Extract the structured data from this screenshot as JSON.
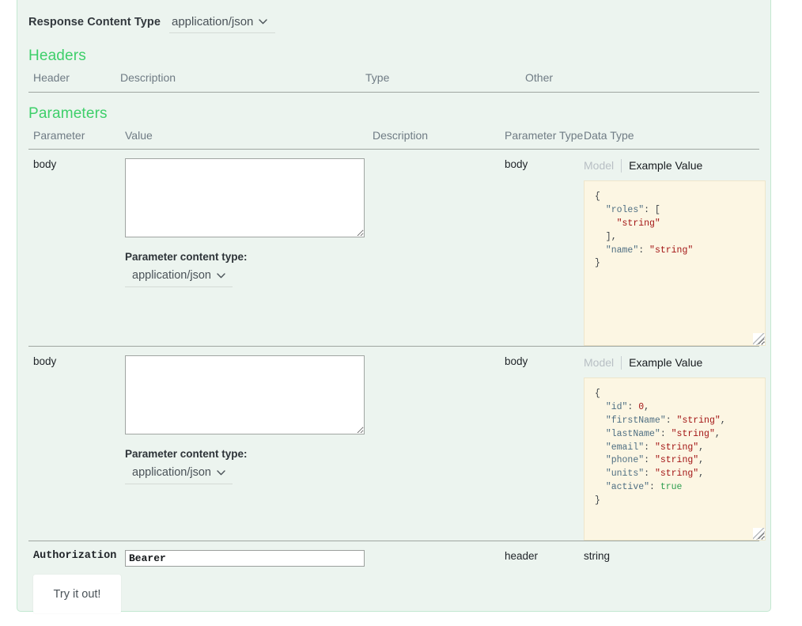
{
  "response_content_type": {
    "label": "Response Content Type",
    "value": "application/json",
    "chevron_icon": "chevron-down-icon"
  },
  "headers_section": {
    "title": "Headers",
    "columns": [
      "Header",
      "Description",
      "Type",
      "Other"
    ],
    "rows": []
  },
  "parameters_section": {
    "title": "Parameters",
    "columns": {
      "parameter": "Parameter",
      "value": "Value",
      "description": "Description",
      "parameter_type": "Parameter Type",
      "data_type": "Data Type"
    },
    "rows": [
      {
        "parameter": "body",
        "value": "",
        "value_placeholder": "",
        "description": "",
        "parameter_type": "body",
        "content_type_label": "Parameter content type:",
        "content_type_value": "application/json",
        "signature_tabs": {
          "model": "Model",
          "example": "Example Value",
          "active": "Example Value"
        },
        "example_lines": [
          [
            {
              "t": "{",
              "c": "punc"
            }
          ],
          [
            {
              "t": "  ",
              "c": "punc"
            },
            {
              "t": "\"roles\"",
              "c": "key"
            },
            {
              "t": ": [",
              "c": "punc"
            }
          ],
          [
            {
              "t": "    ",
              "c": "punc"
            },
            {
              "t": "\"string\"",
              "c": "str"
            }
          ],
          [
            {
              "t": "  ],",
              "c": "punc"
            }
          ],
          [
            {
              "t": "  ",
              "c": "punc"
            },
            {
              "t": "\"name\"",
              "c": "key"
            },
            {
              "t": ": ",
              "c": "punc"
            },
            {
              "t": "\"string\"",
              "c": "str"
            }
          ],
          [
            {
              "t": "}",
              "c": "punc"
            }
          ]
        ]
      },
      {
        "parameter": "body",
        "value": "",
        "value_placeholder": "",
        "description": "",
        "parameter_type": "body",
        "content_type_label": "Parameter content type:",
        "content_type_value": "application/json",
        "signature_tabs": {
          "model": "Model",
          "example": "Example Value",
          "active": "Example Value"
        },
        "example_lines": [
          [
            {
              "t": "{",
              "c": "punc"
            }
          ],
          [
            {
              "t": "  ",
              "c": "punc"
            },
            {
              "t": "\"id\"",
              "c": "key"
            },
            {
              "t": ": ",
              "c": "punc"
            },
            {
              "t": "0",
              "c": "num"
            },
            {
              "t": ",",
              "c": "punc"
            }
          ],
          [
            {
              "t": "  ",
              "c": "punc"
            },
            {
              "t": "\"firstName\"",
              "c": "key"
            },
            {
              "t": ": ",
              "c": "punc"
            },
            {
              "t": "\"string\"",
              "c": "str"
            },
            {
              "t": ",",
              "c": "punc"
            }
          ],
          [
            {
              "t": "  ",
              "c": "punc"
            },
            {
              "t": "\"lastName\"",
              "c": "key"
            },
            {
              "t": ": ",
              "c": "punc"
            },
            {
              "t": "\"string\"",
              "c": "str"
            },
            {
              "t": ",",
              "c": "punc"
            }
          ],
          [
            {
              "t": "  ",
              "c": "punc"
            },
            {
              "t": "\"email\"",
              "c": "key"
            },
            {
              "t": ": ",
              "c": "punc"
            },
            {
              "t": "\"string\"",
              "c": "str"
            },
            {
              "t": ",",
              "c": "punc"
            }
          ],
          [
            {
              "t": "  ",
              "c": "punc"
            },
            {
              "t": "\"phone\"",
              "c": "key"
            },
            {
              "t": ": ",
              "c": "punc"
            },
            {
              "t": "\"string\"",
              "c": "str"
            },
            {
              "t": ",",
              "c": "punc"
            }
          ],
          [
            {
              "t": "  ",
              "c": "punc"
            },
            {
              "t": "\"units\"",
              "c": "key"
            },
            {
              "t": ": ",
              "c": "punc"
            },
            {
              "t": "\"string\"",
              "c": "str"
            },
            {
              "t": ",",
              "c": "punc"
            }
          ],
          [
            {
              "t": "  ",
              "c": "punc"
            },
            {
              "t": "\"active\"",
              "c": "key"
            },
            {
              "t": ": ",
              "c": "punc"
            },
            {
              "t": "true",
              "c": "bool"
            }
          ],
          [
            {
              "t": "}",
              "c": "punc"
            }
          ]
        ]
      }
    ],
    "auth_row": {
      "parameter": "Authorization",
      "value": "Bearer",
      "description": "",
      "parameter_type": "header",
      "data_type": "string"
    }
  },
  "submit": {
    "label": "Try it out!"
  },
  "colors": {
    "panel_bg": "#ecf4ef",
    "panel_border": "#c3e8d1",
    "section_title": "#3ecf6a",
    "example_bg": "#fcf6e3",
    "json_key": "#4f6f83",
    "json_string": "#a31515",
    "json_bool": "#2e9e4f"
  }
}
